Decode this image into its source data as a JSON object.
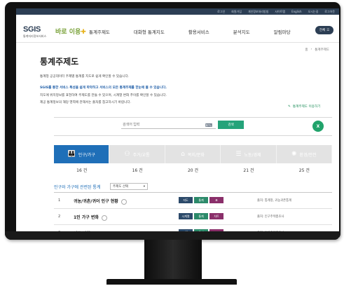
{
  "utilbar": {
    "links": [
      "로그인",
      "회원가입",
      "개인정보처리방침",
      "사이트맵",
      "English",
      "오시는길",
      "로그아웃"
    ]
  },
  "header": {
    "logo_main": "SGIS",
    "logo_sub": "통계지리정보서비스",
    "brand": "바로 이용",
    "nav": [
      "통계주제도",
      "대화형 통계지도",
      "활용서비스",
      "분석지도",
      "알림마당"
    ],
    "menu_label": "전체"
  },
  "breadcrumb": [
    "홈",
    "통계주제도"
  ],
  "page": {
    "title": "통계주제도",
    "desc_lines": [
      "통계청 공공데이터 주제별 통계를 지도로 쉽게 확인할 수 있습니다.",
      "SGIS를 통한 서비스 특성을 쉽게 파악하고 서비스의 모든 통계주제를 한눈에 볼 수 있습니다.",
      "지도에 위치정보를 표현하여 주제도를 만들 수 있으며, 시계열 변화 추이를 확인할 수 있습니다.",
      "제공 통계정보의 해당 영역에 관해서는 출처를 참고하시기 바랍니다."
    ],
    "book_link": "통계주제도 이용하기"
  },
  "search": {
    "placeholder": "검색어 입력",
    "button": "검색",
    "excel_label": "X"
  },
  "tabs": [
    {
      "label": "인구/가구",
      "icon": "people-icon",
      "count": "16 건",
      "active": true
    },
    {
      "label": "주거/교통",
      "icon": "family-icon",
      "count": "16 건",
      "active": false
    },
    {
      "label": "복지/문화",
      "icon": "house-icon",
      "count": "20 건",
      "active": false
    },
    {
      "label": "노동/경제",
      "icon": "chart-icon",
      "count": "21 건",
      "active": false
    },
    {
      "label": "환경/안전",
      "icon": "bulb-icon",
      "count": "25 건",
      "active": false
    }
  ],
  "related": {
    "label": "인구와 가구에 관련된 통계",
    "select_value": "주제도 선택"
  },
  "rows": [
    {
      "num": "1",
      "title": "귀농/귀촌/귀어 인구 현황",
      "tags": [
        {
          "label": "지도",
          "color": "#2c4a6a"
        },
        {
          "label": "통계",
          "color": "#2c8a6a"
        },
        {
          "label": "표",
          "color": "#8a2f6a"
        }
      ],
      "source": "출처: 통계청, 귀농귀촌통계"
    },
    {
      "num": "2",
      "title": "1인 가구 변화",
      "tags": [
        {
          "label": "시계열",
          "color": "#2c4a6a"
        },
        {
          "label": "통계",
          "color": "#2c8a6a"
        },
        {
          "label": "차트",
          "color": "#8a2f6a"
        }
      ],
      "source": "출처: 인구주택총조사"
    },
    {
      "num": "3",
      "title": "인구 변화",
      "tags": [
        {
          "label": "지도",
          "color": "#2c4a6a"
        },
        {
          "label": "통계",
          "color": "#2c8a6a"
        },
        {
          "label": "표",
          "color": "#8a2f6a"
        }
      ],
      "source": "출처: 인구주택총조사"
    }
  ]
}
